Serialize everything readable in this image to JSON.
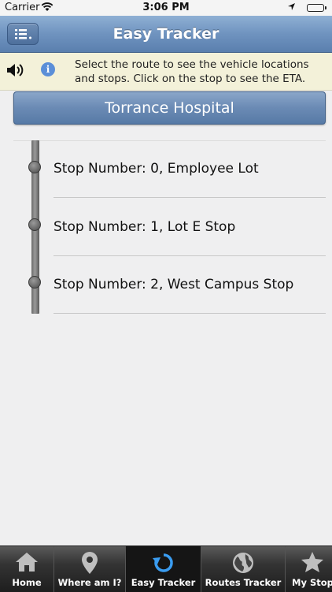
{
  "status_bar": {
    "carrier": "Carrier",
    "time": "3:06 PM"
  },
  "nav": {
    "title": "Easy Tracker",
    "menu_icon": "list-icon"
  },
  "info": {
    "text": "Select the route to see the vehicle locations and stops. Click on the stop to see the ETA.",
    "info_glyph": "i"
  },
  "route": {
    "name": "Torrance Hospital"
  },
  "stops": [
    {
      "label": "Stop Number: 0, Employee Lot"
    },
    {
      "label": "Stop Number: 1, Lot E Stop"
    },
    {
      "label": "Stop Number: 2, West Campus Stop"
    }
  ],
  "tabs": [
    {
      "label": "Home",
      "icon": "home-icon",
      "active": false
    },
    {
      "label": "Where am I?",
      "icon": "location-pin-icon",
      "active": false
    },
    {
      "label": "Easy Tracker",
      "icon": "refresh-icon",
      "active": true
    },
    {
      "label": "Routes Tracker",
      "icon": "globe-icon",
      "active": false
    },
    {
      "label": "My Stops",
      "icon": "star-icon",
      "active": false
    }
  ],
  "colors": {
    "accent": "#6f93bf",
    "active_icon": "#3a9cf0",
    "banner": "#f3f1d9"
  }
}
